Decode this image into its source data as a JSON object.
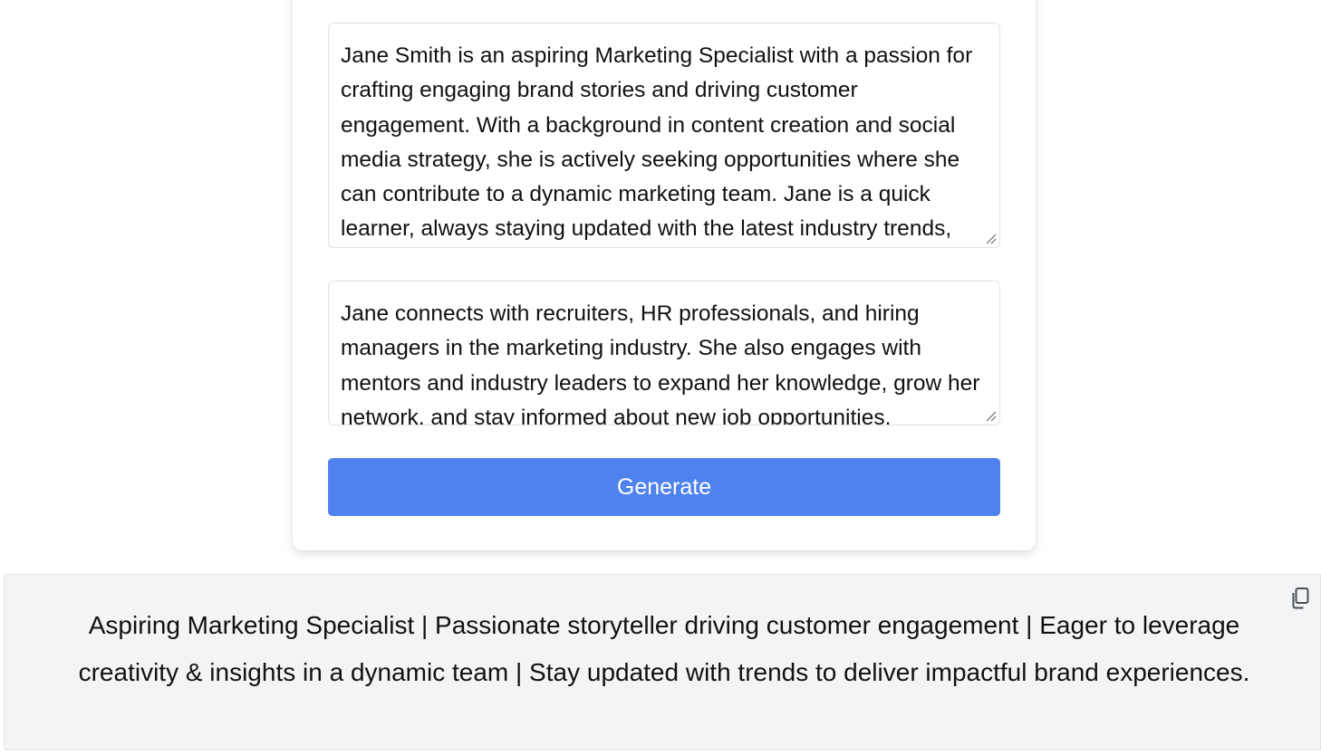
{
  "form": {
    "bio_value": "Jane Smith is an aspiring Marketing Specialist with a passion for crafting engaging brand stories and driving customer engagement. With a background in content creation and social media strategy, she is actively seeking opportunities where she can contribute to a dynamic marketing team. Jane is a quick learner, always staying updated with the latest industry trends,",
    "connections_value": "Jane connects with recruiters, HR professionals, and hiring managers in the marketing industry. She also engages with mentors and industry leaders to expand her knowledge, grow her network, and stay informed about new job opportunities.",
    "generate_label": "Generate"
  },
  "output": {
    "text": "Aspiring Marketing Specialist | Passionate storyteller driving customer engagement | Eager to leverage creativity & insights in a dynamic team | Stay updated with trends to deliver impactful brand experiences.",
    "copy_icon": "copy-icon"
  },
  "colors": {
    "accent": "#4f82ee",
    "output_bg": "#f3f4f6"
  }
}
